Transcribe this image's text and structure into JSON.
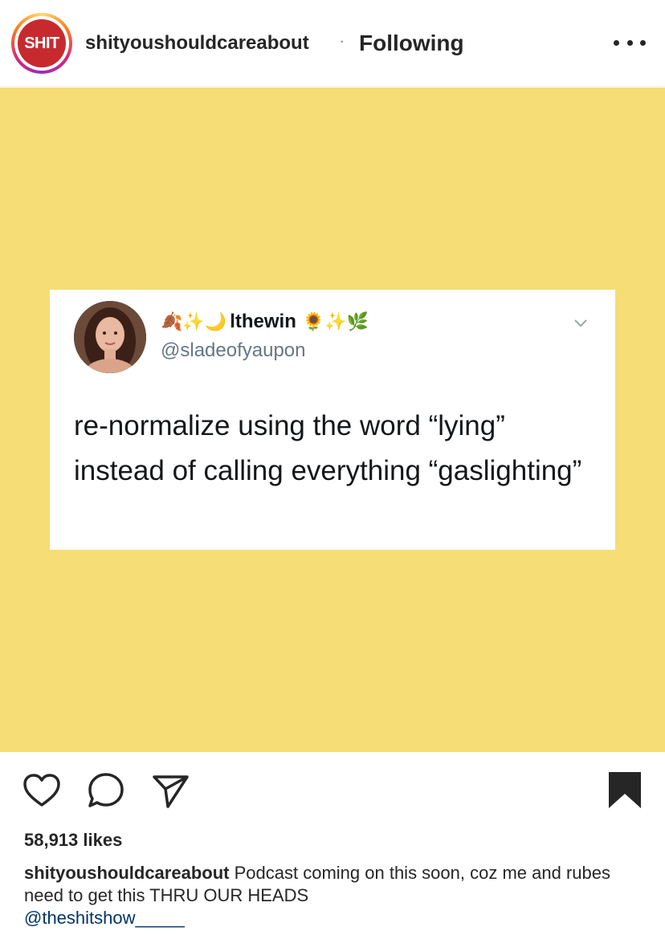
{
  "header": {
    "avatar_text": "SHIT",
    "username": "shityoushouldcareabout",
    "separator": "·",
    "follow_status": "Following",
    "more_icon": "more-horizontal-icon"
  },
  "tweet": {
    "display_name": "lthewin",
    "emoji_before": "🍂✨🌙",
    "emoji_after": "🌻✨🌿",
    "handle": "@sladeofyaupon",
    "text": "re-normalize using the word “lying” instead of calling everything “gaslighting”"
  },
  "colors": {
    "post_background": "#f6dd76",
    "avatar_red": "#c62a2f",
    "link_blue": "#003569"
  },
  "actions": {
    "like_icon": "heart-icon",
    "comment_icon": "comment-icon",
    "share_icon": "send-icon",
    "save_icon": "bookmark-filled-icon"
  },
  "likes": "58,913 likes",
  "caption": {
    "username": "shityoushouldcareabout",
    "text": "Podcast coming on this soon, coz me and rubes need to get this THRU OUR HEADS",
    "mention": "@theshitshow_____"
  }
}
